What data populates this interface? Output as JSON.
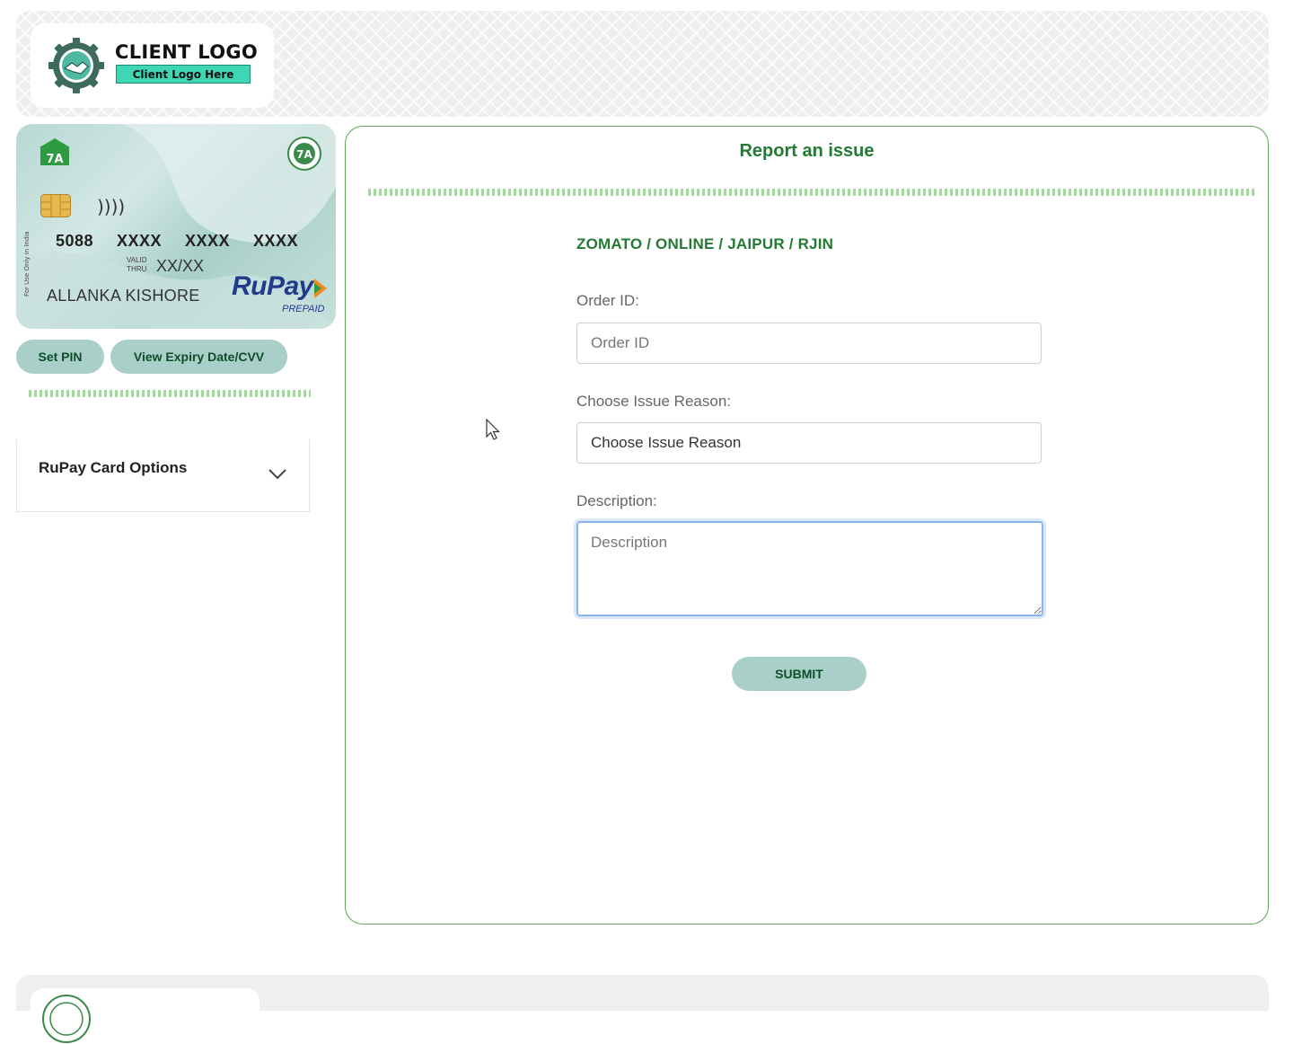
{
  "header": {
    "logo_title": "CLIENT LOGO",
    "logo_tagline": "Client Logo Here"
  },
  "card": {
    "number_groups": [
      "5088",
      "XXXX",
      "XXXX",
      "XXXX"
    ],
    "valid_label_1": "VALID",
    "valid_label_2": "THRU",
    "expiry": "XX/XX",
    "holder_name": "ALLANKA KISHORE",
    "network": "RuPay",
    "network_sub": "PREPAID",
    "side_text": "For Use Only in India",
    "nfc_symbol": "))))"
  },
  "card_actions": {
    "set_pin": "Set PIN",
    "view_expiry": "View Expiry Date/CVV"
  },
  "options": {
    "label": "RuPay Card Options"
  },
  "report": {
    "title": "Report an issue",
    "merchant": "ZOMATO / ONLINE / JAIPUR / RJIN",
    "order_label": "Order ID:",
    "order_placeholder": "Order ID",
    "order_value": "",
    "reason_label": "Choose Issue Reason:",
    "reason_value": "Choose Issue Reason",
    "description_label": "Description:",
    "description_placeholder": "Description",
    "submit": "SUBMIT"
  },
  "icons": {
    "logo": "gear-handshake-icon",
    "card_left": "bank-icon",
    "card_right": "seal-icon",
    "chip": "chip-icon",
    "nfc": "contactless-icon",
    "chevron": "chevron-down-icon",
    "cursor": "mouse-pointer-icon"
  },
  "colors": {
    "accent_green": "#227a33",
    "pill_bg": "#a9cfc9",
    "panel_border": "#62a55c",
    "rupay_blue": "#213b8c",
    "focus_blue": "#8ab4f0"
  }
}
